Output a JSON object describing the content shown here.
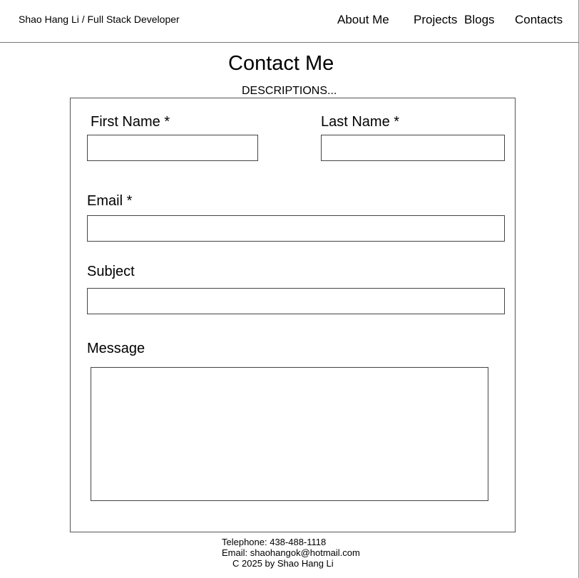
{
  "header": {
    "brand": "Shao Hang Li / Full Stack Developer",
    "nav": {
      "about": "About Me",
      "projects": "Projects",
      "blogs": "Blogs",
      "contacts": "Contacts"
    }
  },
  "main": {
    "title": "Contact Me",
    "description": "DESCRIPTIONS..."
  },
  "form": {
    "first_name": {
      "label": "First Name *",
      "value": ""
    },
    "last_name": {
      "label": "Last Name *",
      "value": ""
    },
    "email": {
      "label": "Email *",
      "value": ""
    },
    "subject": {
      "label": "Subject",
      "value": ""
    },
    "message": {
      "label": "Message",
      "value": ""
    }
  },
  "footer": {
    "telephone": "Telephone: 438-488-1118",
    "email": "Email: shaohangok@hotmail.com",
    "copyright": "C 2025 by Shao Hang Li"
  }
}
